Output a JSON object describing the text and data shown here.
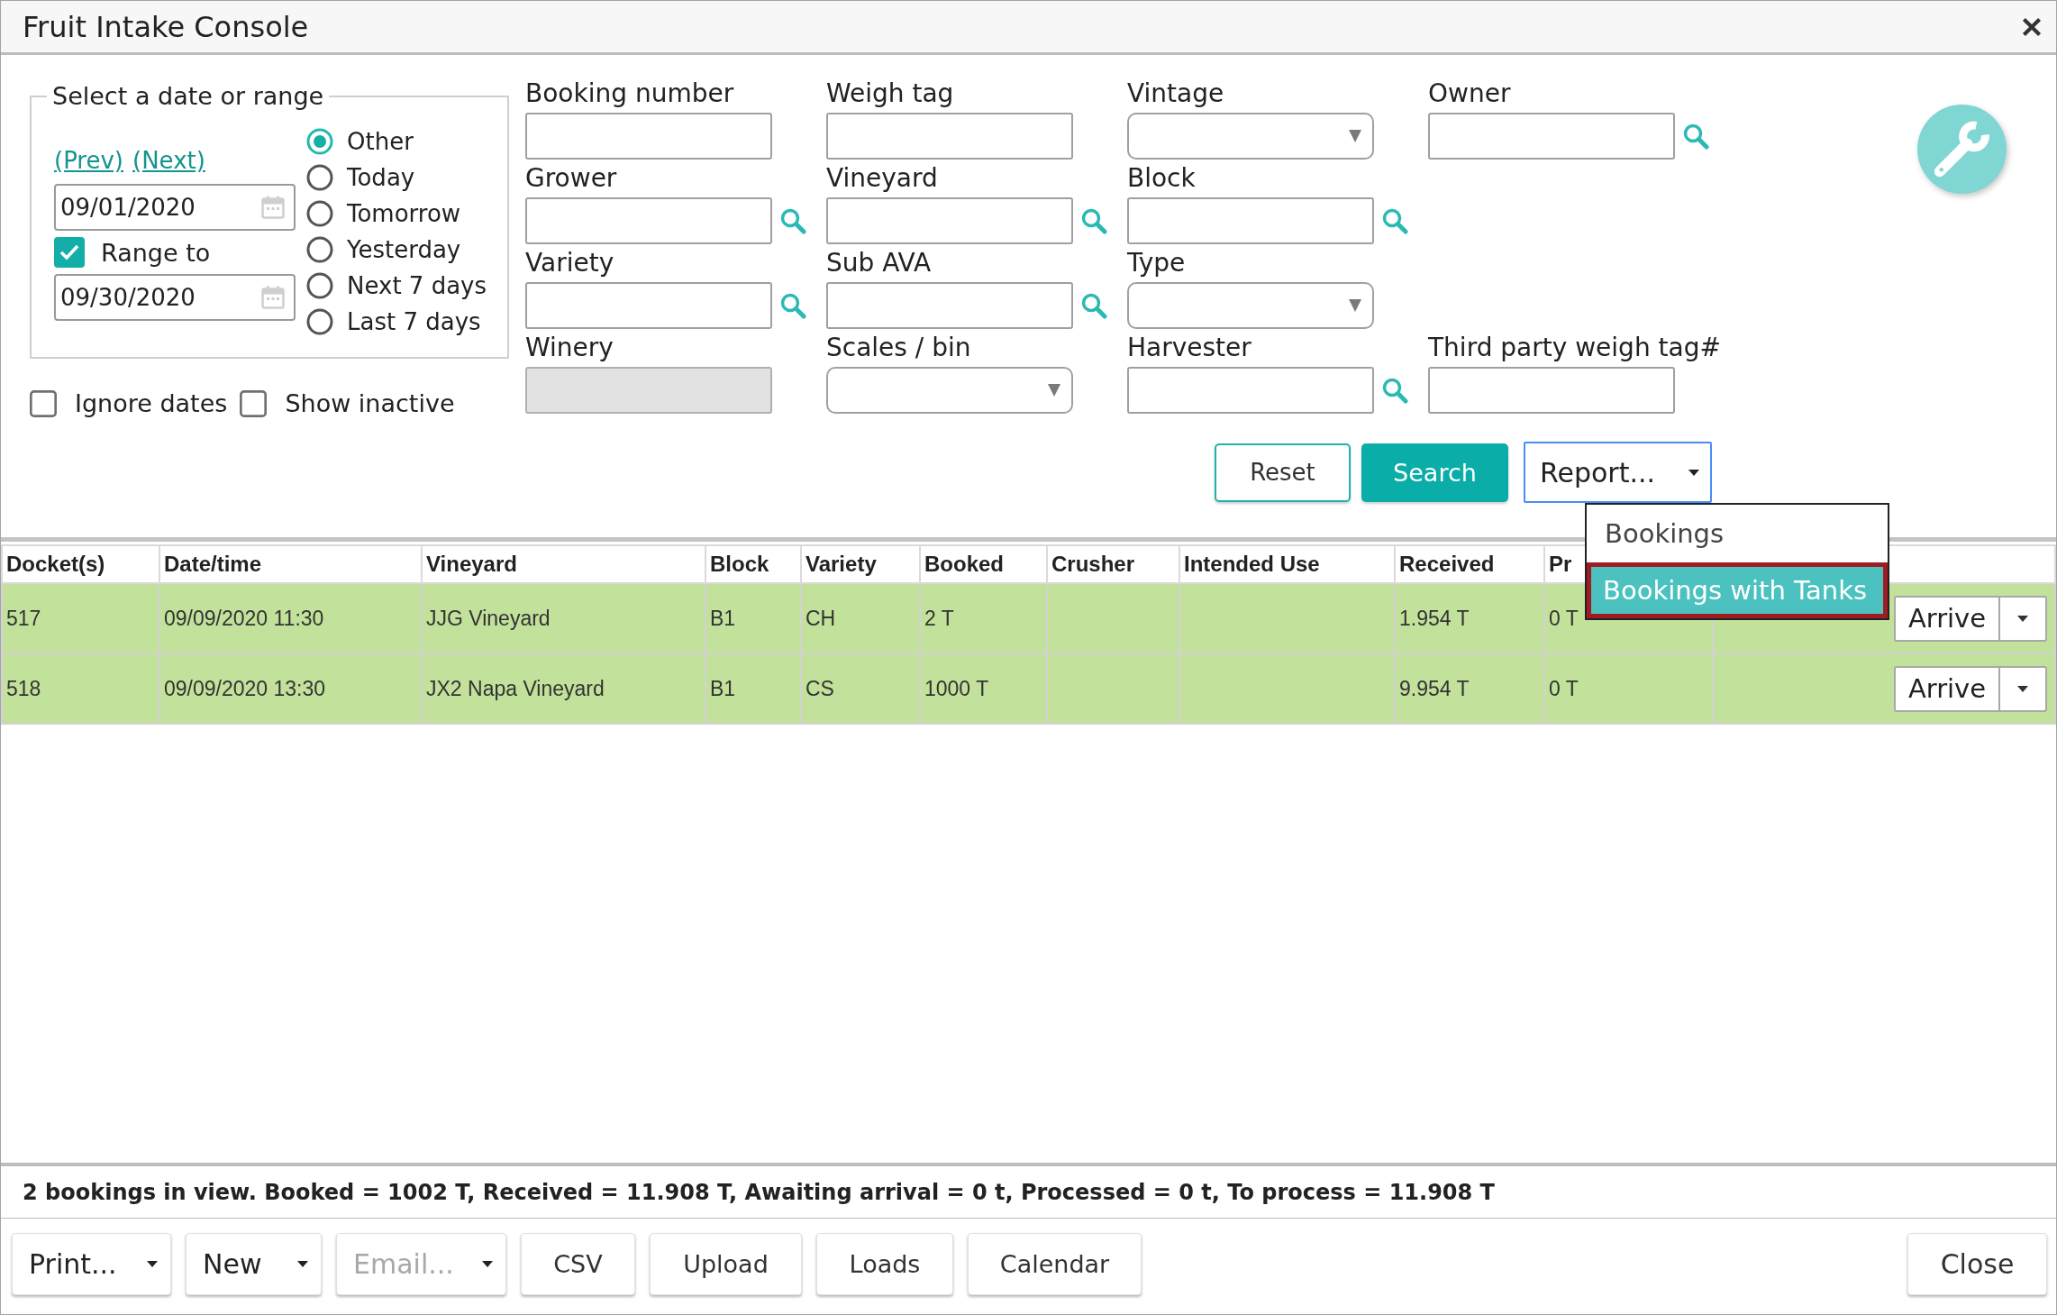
{
  "window": {
    "title": "Fruit Intake Console"
  },
  "date_range": {
    "legend": "Select a date or range",
    "links": [
      "(Prev)",
      "(Next)"
    ],
    "from_date": "09/01/2020",
    "range_to": {
      "label": "Range to",
      "checked": true
    },
    "to_date": "09/30/2020",
    "options": [
      {
        "label": "Other",
        "selected": true
      },
      {
        "label": "Today",
        "selected": false
      },
      {
        "label": "Tomorrow",
        "selected": false
      },
      {
        "label": "Yesterday",
        "selected": false
      },
      {
        "label": "Next 7 days",
        "selected": false
      },
      {
        "label": "Last 7 days",
        "selected": false
      }
    ]
  },
  "toggles": [
    {
      "label": "Ignore dates",
      "checked": false
    },
    {
      "label": "Show inactive",
      "checked": false
    }
  ],
  "fields": [
    [
      {
        "label": "Booking number",
        "kind": "text",
        "lookup": false,
        "disabled": false
      },
      {
        "label": "Weigh tag",
        "kind": "text",
        "lookup": false,
        "disabled": false
      },
      {
        "label": "Vintage",
        "kind": "select",
        "lookup": false,
        "disabled": false
      },
      {
        "label": "Owner",
        "kind": "text",
        "lookup": true,
        "disabled": false
      }
    ],
    [
      {
        "label": "Grower",
        "kind": "text",
        "lookup": true,
        "disabled": false
      },
      {
        "label": "Vineyard",
        "kind": "text",
        "lookup": true,
        "disabled": false
      },
      {
        "label": "Block",
        "kind": "text",
        "lookup": true,
        "disabled": false
      }
    ],
    [
      {
        "label": "Variety",
        "kind": "text",
        "lookup": true,
        "disabled": false
      },
      {
        "label": "Sub AVA",
        "kind": "text",
        "lookup": true,
        "disabled": false
      },
      {
        "label": "Type",
        "kind": "select",
        "lookup": false,
        "disabled": false
      }
    ],
    [
      {
        "label": "Winery",
        "kind": "text",
        "lookup": false,
        "disabled": true
      },
      {
        "label": "Scales / bin",
        "kind": "select",
        "lookup": false,
        "disabled": false
      },
      {
        "label": "Harvester",
        "kind": "text",
        "lookup": true,
        "disabled": false
      },
      {
        "label": "Third party weigh tag#",
        "kind": "text",
        "lookup": false,
        "disabled": false
      }
    ]
  ],
  "actions": {
    "reset": "Reset",
    "search": "Search",
    "report": {
      "label": "Report...",
      "expanded": true,
      "items": [
        {
          "label": "Bookings",
          "selected": false
        },
        {
          "label": "Bookings with Tanks",
          "selected": true
        }
      ]
    }
  },
  "table": {
    "columns": [
      "Docket(s)",
      "Date/time",
      "Vineyard",
      "Block",
      "Variety",
      "Booked",
      "Crusher",
      "Intended Use",
      "Received",
      "Pr"
    ],
    "rows": [
      {
        "cells": [
          "517",
          "09/09/2020 11:30",
          "JJG Vineyard",
          "B1",
          "CH",
          "2 T",
          null,
          null,
          "1.954 T",
          "0 T"
        ],
        "action": "Arrive"
      },
      {
        "cells": [
          "518",
          "09/09/2020 13:30",
          "JX2 Napa Vineyard",
          "B1",
          "CS",
          "1000 T",
          null,
          null,
          "9.954 T",
          "0 T"
        ],
        "action": "Arrive"
      }
    ]
  },
  "summary": "2 bookings in view. Booked = 1002 T, Received = 11.908 T, Awaiting arrival = 0 t, Processed = 0 t, To process = 11.908 T",
  "buttons": [
    {
      "label": "Print...",
      "kind": "menu",
      "disabled": false
    },
    {
      "label": "New",
      "kind": "menu",
      "disabled": false
    },
    {
      "label": "Email...",
      "kind": "menu",
      "disabled": true
    },
    {
      "label": "CSV",
      "kind": "plain",
      "disabled": false
    },
    {
      "label": "Upload",
      "kind": "plain",
      "disabled": false
    },
    {
      "label": "Loads",
      "kind": "plain",
      "disabled": false
    },
    {
      "label": "Calendar",
      "kind": "plain",
      "disabled": false
    }
  ],
  "close_button": "Close"
}
